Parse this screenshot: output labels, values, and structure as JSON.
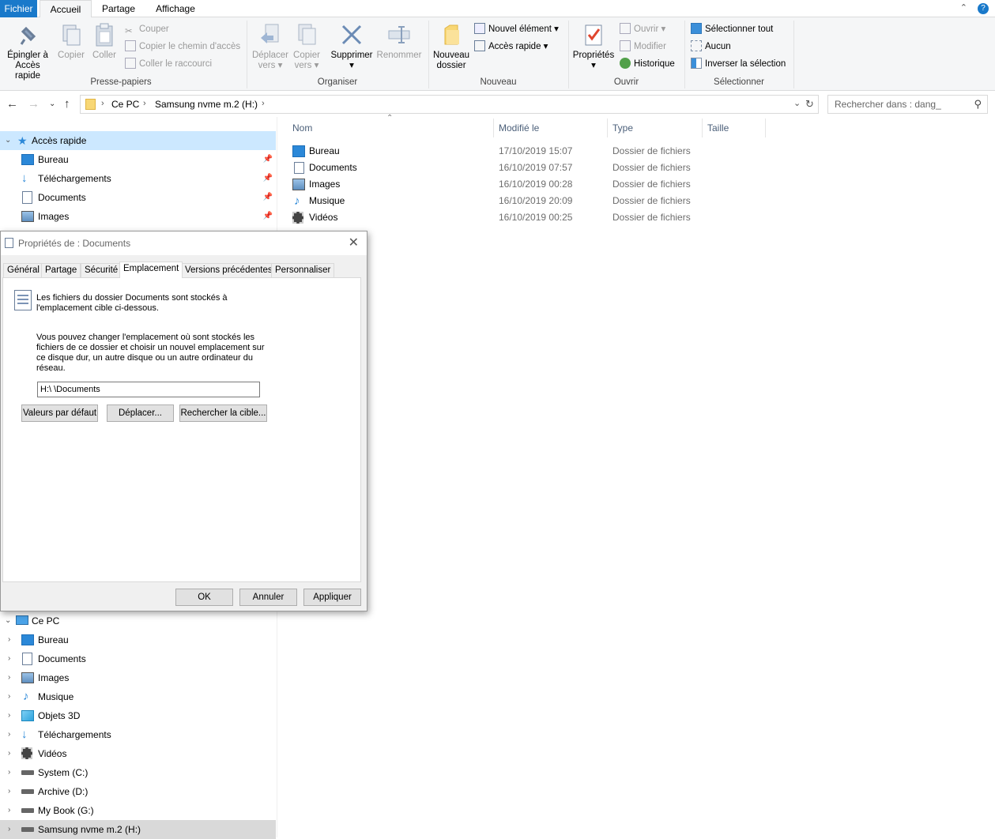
{
  "ribbon_tabs": [
    "Fichier",
    "Accueil",
    "Partage",
    "Affichage"
  ],
  "ribbon": {
    "pin_label_1": "Épingler à",
    "pin_label_2": "Accès rapide",
    "copy": "Copier",
    "paste": "Coller",
    "cut": "Couper",
    "copy_path": "Copier le chemin d'accès",
    "paste_shortcut": "Coller le raccourci",
    "group_clipboard": "Presse-papiers",
    "move_1": "Déplacer",
    "move_2": "vers",
    "copyto_1": "Copier",
    "copyto_2": "vers",
    "delete": "Supprimer",
    "rename": "Renommer",
    "group_organize": "Organiser",
    "newfolder_1": "Nouveau",
    "newfolder_2": "dossier",
    "new_item": "Nouvel élément",
    "easy_access": "Accès rapide",
    "group_new": "Nouveau",
    "properties": "Propriétés",
    "open": "Ouvrir",
    "edit": "Modifier",
    "history": "Historique",
    "group_open": "Ouvrir",
    "select_all": "Sélectionner tout",
    "select_none": "Aucun",
    "invert": "Inverser la sélection",
    "group_select": "Sélectionner"
  },
  "address": {
    "crumbs": [
      "Ce PC",
      "Samsung nvme m.2 (H:)"
    ],
    "search_placeholder": "Rechercher dans : dang_"
  },
  "nav": {
    "quick_access": "Accès rapide",
    "quick_items": [
      "Bureau",
      "Téléchargements",
      "Documents",
      "Images"
    ],
    "this_pc": "Ce PC",
    "pc_items": [
      "Bureau",
      "Documents",
      "Images",
      "Musique",
      "Objets 3D",
      "Téléchargements",
      "Vidéos",
      "System (C:)",
      "Archive (D:)",
      "My Book (G:)",
      "Samsung nvme m.2 (H:)"
    ]
  },
  "columns": [
    "Nom",
    "Modifié le",
    "Type",
    "Taille"
  ],
  "files": [
    {
      "name": "Bureau",
      "date": "17/10/2019 15:07",
      "type": "Dossier de fichiers",
      "icon": "desktop-icon"
    },
    {
      "name": "Documents",
      "date": "16/10/2019 07:57",
      "type": "Dossier de fichiers",
      "icon": "document-icon"
    },
    {
      "name": "Images",
      "date": "16/10/2019 00:28",
      "type": "Dossier de fichiers",
      "icon": "pictures-icon"
    },
    {
      "name": "Musique",
      "date": "16/10/2019 20:09",
      "type": "Dossier de fichiers",
      "icon": "music-icon"
    },
    {
      "name": "Vidéos",
      "date": "16/10/2019 00:25",
      "type": "Dossier de fichiers",
      "icon": "video-icon"
    }
  ],
  "dialog": {
    "title": "Propriétés de : Documents",
    "tabs": [
      "Général",
      "Partage",
      "Sécurité",
      "Emplacement",
      "Versions précédentes",
      "Personnaliser"
    ],
    "text1_l1": "Les fichiers du dossier Documents sont stockés à",
    "text1_l2": "l'emplacement cible ci-dessous.",
    "text2_l1": "Vous pouvez changer l'emplacement où sont stockés les",
    "text2_l2": "fichiers de ce dossier et choisir un nouvel emplacement sur",
    "text2_l3": "ce disque dur, un autre disque ou un autre ordinateur du",
    "text2_l4": "réseau.",
    "path": "H:\\          \\Documents",
    "btn_default": "Valeurs par défaut",
    "btn_move": "Déplacer...",
    "btn_find": "Rechercher la cible...",
    "btn_ok": "OK",
    "btn_cancel": "Annuler",
    "btn_apply": "Appliquer"
  },
  "colors": {
    "accent": "#1979ca",
    "selection": "#cce8ff",
    "folder": "#f8d775"
  }
}
